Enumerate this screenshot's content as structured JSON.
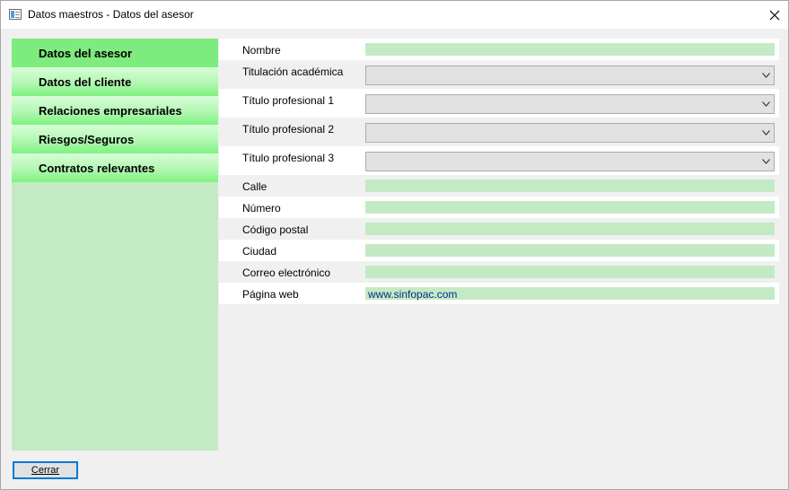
{
  "window": {
    "title": "Datos maestros - Datos del asesor",
    "icon": "app-window-icon",
    "close_icon": "close-icon"
  },
  "nav": {
    "items": [
      {
        "label": "Datos del asesor",
        "active": true
      },
      {
        "label": "Datos del cliente",
        "active": false
      },
      {
        "label": "Relaciones empresariales",
        "active": false
      },
      {
        "label": "Riesgos/Seguros",
        "active": false
      },
      {
        "label": "Contratos relevantes",
        "active": false
      }
    ]
  },
  "form": {
    "fields": [
      {
        "label": "Nombre",
        "type": "text",
        "value": ""
      },
      {
        "label": "Titulación académica",
        "type": "select",
        "value": ""
      },
      {
        "label": "Título profesional 1",
        "type": "select",
        "value": ""
      },
      {
        "label": "Título profesional 2",
        "type": "select",
        "value": ""
      },
      {
        "label": "Título profesional 3",
        "type": "select",
        "value": ""
      },
      {
        "label": "Calle",
        "type": "text",
        "value": ""
      },
      {
        "label": "Número",
        "type": "text",
        "value": ""
      },
      {
        "label": "Código postal",
        "type": "text",
        "value": ""
      },
      {
        "label": "Ciudad",
        "type": "text",
        "value": ""
      },
      {
        "label": "Correo electrónico",
        "type": "text",
        "value": ""
      },
      {
        "label": "Página web",
        "type": "text",
        "value": "www.sinfopac.com"
      }
    ]
  },
  "footer": {
    "close_label": "Cerrar"
  },
  "colors": {
    "nav_active": "#7deb7d",
    "nav_panel": "#c4eac4",
    "field_bg": "#c4eac4",
    "focus_border": "#0078d7",
    "link_text": "#0b2a8c"
  }
}
